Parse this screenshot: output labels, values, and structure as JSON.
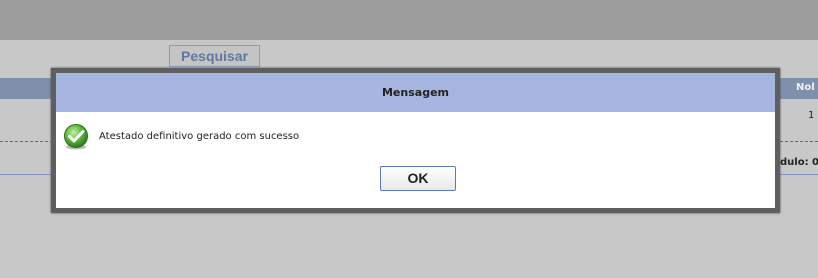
{
  "background": {
    "search_button_label": "Pesquisar",
    "header_right_fragment": "Nol",
    "row_right_fragment": "1",
    "footer_right_fragment": "dulo: 0"
  },
  "dialog": {
    "title": "Mensagem",
    "message": "Atestado definitivo gerado com sucesso",
    "status_icon": "check-success-icon",
    "ok_label": "OK"
  },
  "colors": {
    "title_bar": "#a6b6e0",
    "dialog_frame": "#5f5f5f",
    "ok_border": "#5c78c0",
    "success_green": "#4caf2f"
  }
}
